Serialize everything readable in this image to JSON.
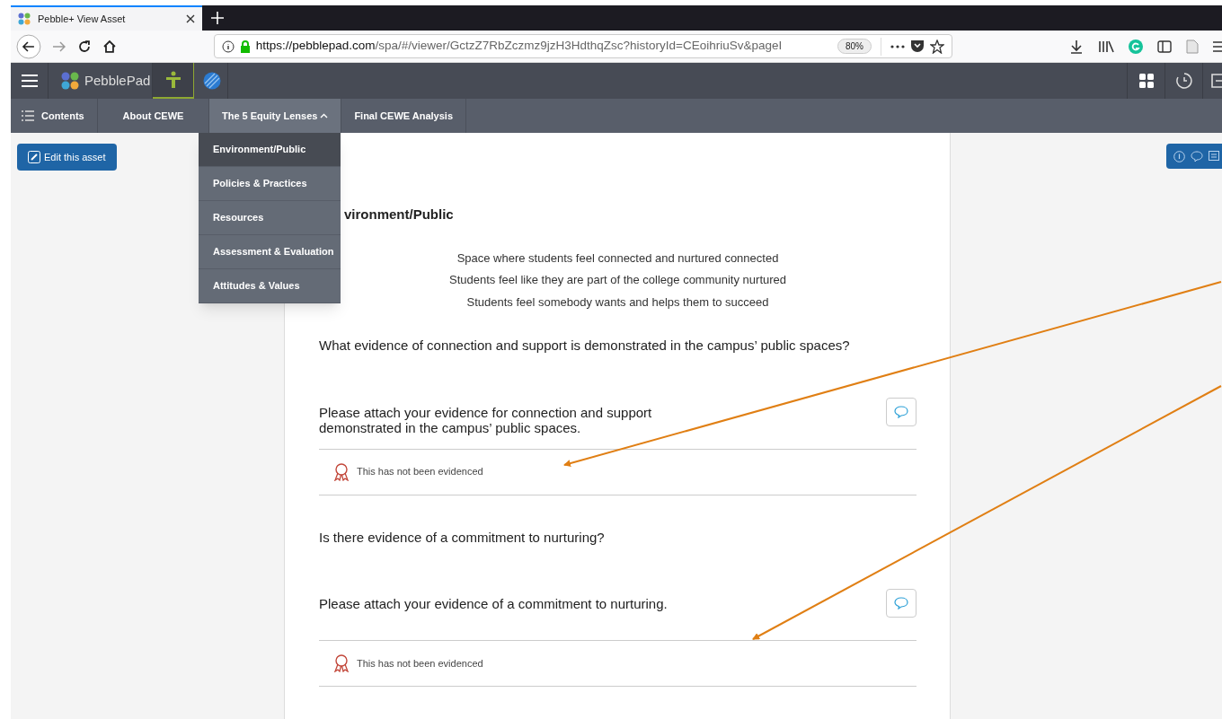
{
  "browser": {
    "tab_title": "Pebble+ View Asset",
    "url_host": "https://pebblepad.com",
    "url_path": "/spa/#/viewer/GctzZ7RbZczmz9jzH3HdthqZsc?historyId=CEoihriuSv&pageI",
    "zoom": "80%"
  },
  "app": {
    "logo_text": "PebblePad"
  },
  "nav": {
    "contents": "Contents",
    "items": [
      {
        "label": "About CEWE",
        "selected": false,
        "expanded": false
      },
      {
        "label": "The 5 Equity Lenses",
        "selected": true,
        "expanded": true
      },
      {
        "label": "Final CEWE Analysis",
        "selected": false,
        "expanded": false
      }
    ]
  },
  "dropdown": [
    {
      "label": "Environment/Public",
      "selected": true
    },
    {
      "label": "Policies & Practices",
      "selected": false
    },
    {
      "label": "Resources",
      "selected": false
    },
    {
      "label": "Assessment & Evaluation",
      "selected": false
    },
    {
      "label": "Attitudes & Values",
      "selected": false
    }
  ],
  "edit_button": "Edit this asset",
  "page": {
    "heading": "vironment/Public",
    "statements": [
      "Space where students feel connected and nurtured connected",
      "Students feel like they are part of the college community nurtured",
      "Students feel somebody wants and helps them to succeed"
    ],
    "sections": [
      {
        "question": "What evidence of connection and support is demonstrated in the campus’ public spaces?",
        "prompt_lines": [
          "Please attach your evidence for connection and support",
          "demonstrated in the campus’ public spaces."
        ],
        "evidence": "This has not been evidenced"
      },
      {
        "question": "Is there evidence of a commitment to nurturing?",
        "prompt_lines": [
          "Please attach your evidence of a commitment to nurturing."
        ],
        "evidence": "This has not been evidenced"
      }
    ]
  }
}
